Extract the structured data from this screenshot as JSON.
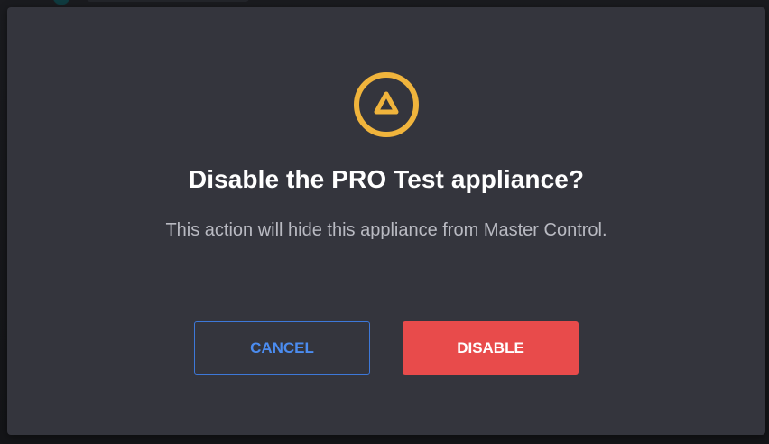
{
  "dialog": {
    "icon": "warning-triangle-icon",
    "title": "Disable the PRO Test appliance?",
    "message": "This action will hide this appliance from Master Control.",
    "cancel_label": "CANCEL",
    "confirm_label": "DISABLE"
  },
  "colors": {
    "dialog_background": "#34353d",
    "warning_accent": "#f0b43c",
    "cancel_accent": "#4b8cf0",
    "danger": "#e84b4b"
  }
}
